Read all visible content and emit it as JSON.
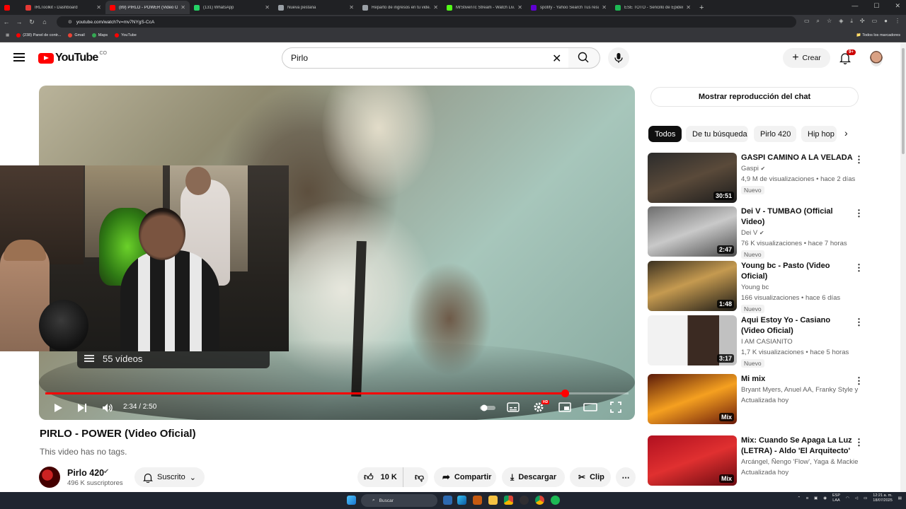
{
  "browser": {
    "tabs": [
      {
        "title": "IRLToolkit › Dashboard",
        "color": "#e53935",
        "active": false
      },
      {
        "title": "(89) PIRLO - POWER (Video Ofi...",
        "color": "#ff0000",
        "active": true
      },
      {
        "title": "(131) WhatsApp",
        "color": "#25d366",
        "active": false
      },
      {
        "title": "Nueva pestaña",
        "color": "#9aa0a6",
        "active": false
      },
      {
        "title": "Reparto de ingresos en tu vide...",
        "color": "#9aa0a6",
        "active": false
      },
      {
        "title": "MrStivenTc Stream - Watch Liv...",
        "color": "#53fc18",
        "active": false
      },
      {
        "title": "spotify - Yahoo Search Tus resu...",
        "color": "#6001d2",
        "active": false
      },
      {
        "title": "ESE TOTO - Sencillo de Epidem...",
        "color": "#1db954",
        "active": false
      }
    ],
    "url": "youtube.com/watch?v=mv7NYgS-CcA",
    "bookmarks": [
      {
        "label": "(238) Panel de contr...",
        "color": "#ff0000"
      },
      {
        "label": "Gmail",
        "color": "#ea4335"
      },
      {
        "label": "Maps",
        "color": "#34a853"
      },
      {
        "label": "YouTube",
        "color": "#ff0000"
      }
    ],
    "all_bookmarks": "Todos los marcadores"
  },
  "header": {
    "logo": "YouTube",
    "country": "CO",
    "search_value": "Pirlo",
    "create_label": "Crear",
    "notif_count": "9+"
  },
  "player": {
    "progress": 0.891,
    "time": "2:34 / 2:50",
    "playlist_count": "55 vídeos",
    "hd_badge": "HD"
  },
  "video": {
    "title": "PIRLO - POWER (Video Oficial)",
    "tags": "This video has no tags.",
    "channel": "Pirlo 420",
    "subscribers": "496 K suscriptores",
    "subscribed_label": "Suscrito",
    "likes": "10 K",
    "share_label": "Compartir",
    "download_label": "Descargar",
    "clip_label": "Clip"
  },
  "sidebar": {
    "chat_replay": "Mostrar reproducción del chat",
    "chips": [
      "Todos",
      "De tu búsqueda",
      "Pirlo 420",
      "Hip hop"
    ],
    "recommendations": [
      {
        "title": "GASPI CAMINO A LA VELADA",
        "channel": "Gaspi",
        "verified": true,
        "stats": "4,9 M de visualizaciones • hace 2 días",
        "badge": "Nuevo",
        "duration": "30:51"
      },
      {
        "title": "Dei V - TUMBAO (Official Video)",
        "channel": "Dei V",
        "verified": true,
        "stats": "76 K visualizaciones • hace 7 horas",
        "badge": "Nuevo",
        "duration": "2:47"
      },
      {
        "title": "Young bc - Pasto (Video Oficial)",
        "channel": "Young bc",
        "verified": false,
        "stats": "166 visualizaciones • hace 6 días",
        "badge": "Nuevo",
        "duration": "1:48"
      },
      {
        "title": "Aqui Estoy Yo - Casiano (Video Oficial)",
        "channel": "I AM CASIANITO",
        "verified": false,
        "stats": "1,7 K visualizaciones • hace 5 horas",
        "badge": "Nuevo",
        "duration": "3:17"
      },
      {
        "title": "Mi mix",
        "channel": "Bryant Myers, Anuel AA, Franky Style y m...",
        "verified": false,
        "stats": "Actualizada hoy",
        "badge": "",
        "duration": "Mix"
      },
      {
        "title": "Mix: Cuando Se Apaga La Luz (LETRA) - Aldo 'El Arquitecto' ...",
        "channel": "Arcángel, Ñengo 'Flow', Yaga & Mackie y ...",
        "verified": false,
        "stats": "Actualizada hoy",
        "badge": "",
        "duration": "Mix"
      }
    ]
  },
  "taskbar": {
    "search": "Buscar",
    "lang_top": "ESP",
    "lang_bottom": "LAA",
    "time": "12:21 a. m.",
    "date": "18/07/2025"
  }
}
